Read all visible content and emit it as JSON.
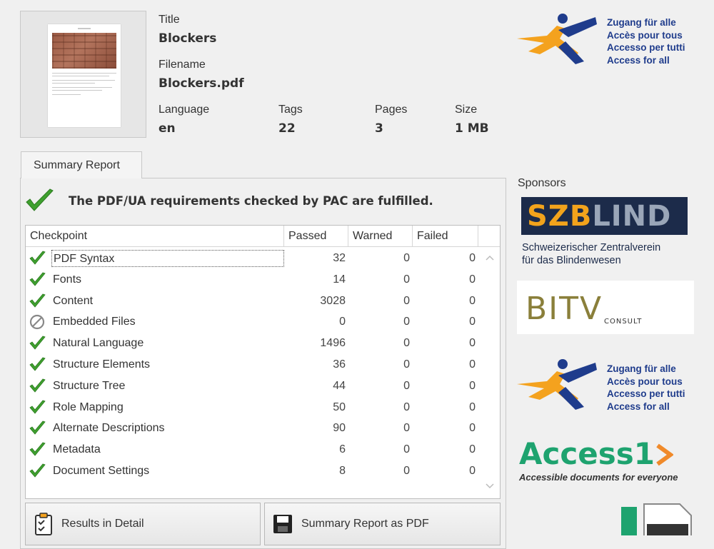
{
  "document": {
    "title_label": "Title",
    "title_value": "Blockers",
    "filename_label": "Filename",
    "filename_value": "Blockers.pdf",
    "language_label": "Language",
    "language_value": "en",
    "tags_label": "Tags",
    "tags_value": "22",
    "pages_label": "Pages",
    "pages_value": "3",
    "size_label": "Size",
    "size_value": "1 MB"
  },
  "tabs": [
    {
      "label": "Summary Report"
    }
  ],
  "summary": {
    "message": "The PDF/UA requirements checked by PAC are fulfilled."
  },
  "table": {
    "columns": [
      "Checkpoint",
      "Passed",
      "Warned",
      "Failed"
    ],
    "rows": [
      {
        "name": "PDF Syntax",
        "passed": "32",
        "warned": "0",
        "failed": "0",
        "status": "pass"
      },
      {
        "name": "Fonts",
        "passed": "14",
        "warned": "0",
        "failed": "0",
        "status": "pass"
      },
      {
        "name": "Content",
        "passed": "3028",
        "warned": "0",
        "failed": "0",
        "status": "pass"
      },
      {
        "name": "Embedded Files",
        "passed": "0",
        "warned": "0",
        "failed": "0",
        "status": "none"
      },
      {
        "name": "Natural Language",
        "passed": "1496",
        "warned": "0",
        "failed": "0",
        "status": "pass"
      },
      {
        "name": "Structure Elements",
        "passed": "36",
        "warned": "0",
        "failed": "0",
        "status": "pass"
      },
      {
        "name": "Structure Tree",
        "passed": "44",
        "warned": "0",
        "failed": "0",
        "status": "pass"
      },
      {
        "name": "Role Mapping",
        "passed": "50",
        "warned": "0",
        "failed": "0",
        "status": "pass"
      },
      {
        "name": "Alternate Descriptions",
        "passed": "90",
        "warned": "0",
        "failed": "0",
        "status": "pass"
      },
      {
        "name": "Metadata",
        "passed": "6",
        "warned": "0",
        "failed": "0",
        "status": "pass"
      },
      {
        "name": "Document Settings",
        "passed": "8",
        "warned": "0",
        "failed": "0",
        "status": "pass"
      }
    ]
  },
  "buttons": {
    "results_detail": "Results in Detail",
    "summary_pdf": "Summary Report as PDF"
  },
  "sponsors": {
    "label": "Sponsors",
    "szb_logo_text_a": "SZB",
    "szb_logo_text_b": "LIND",
    "szb_subtitle_1": "Schweizerischer Zentralverein",
    "szb_subtitle_2": "für das Blindenwesen",
    "bitv_text": "BITV",
    "bitv_small": "CONSULT",
    "access_text": "Access1",
    "access_tagline": "Accessible documents for everyone",
    "access_for_all_lines": [
      "Zugang für alle",
      "Accès pour tous",
      "Accesso per tutti",
      "Access for all"
    ]
  },
  "colors": {
    "check_green": "#3fa02f",
    "access_green": "#1ea36f",
    "afa_blue": "#1f3c8c",
    "afa_orange": "#f4a21e"
  }
}
